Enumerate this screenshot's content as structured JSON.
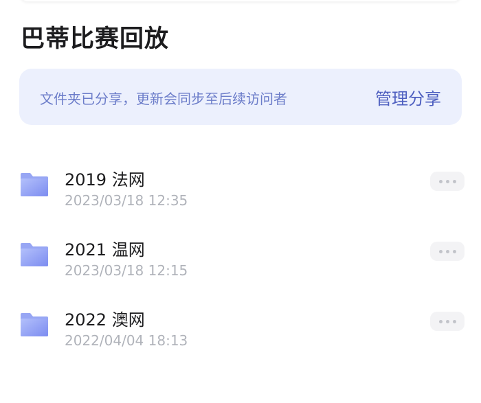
{
  "header": {
    "title": "巴蒂比赛回放"
  },
  "share_banner": {
    "message": "文件夹已分享，更新会同步至后续访问者",
    "manage_label": "管理分享"
  },
  "folders": [
    {
      "name": "2019 法网",
      "date": "2023/03/18 12:35"
    },
    {
      "name": "2021 温网",
      "date": "2023/03/18 12:15"
    },
    {
      "name": "2022 澳网",
      "date": "2022/04/04 18:13"
    }
  ],
  "icons": {
    "folder": "folder-icon",
    "more": "more-options-icon"
  },
  "colors": {
    "banner_bg": "#ecf0fd",
    "banner_text": "#6b7cc9",
    "accent": "#4e5fc0",
    "folder_light": "#a8b6f7",
    "folder_dark": "#7f8ff0"
  }
}
